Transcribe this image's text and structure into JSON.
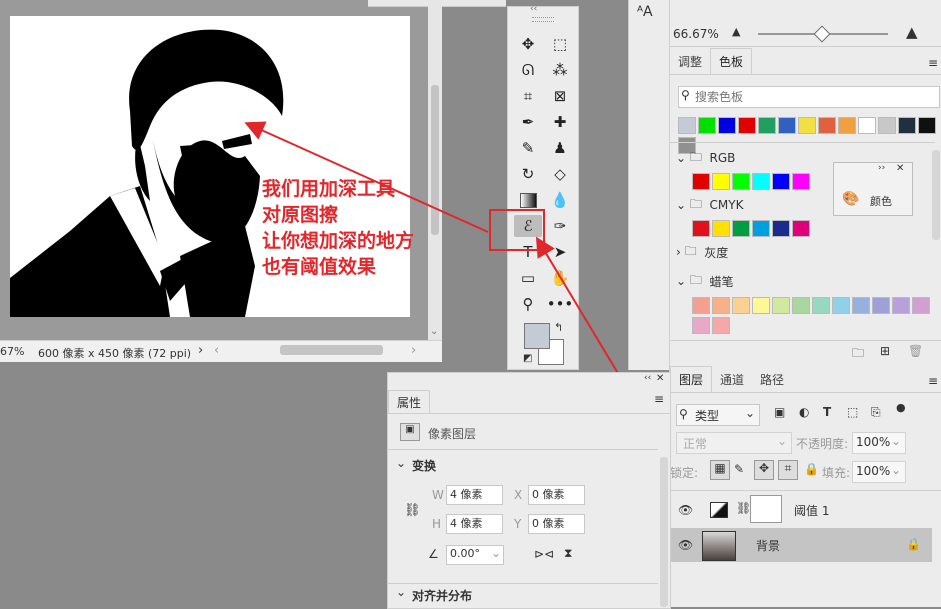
{
  "document": {
    "zoom": "67%",
    "size_info": "600 像素 x 450 像素 (72 ppi)"
  },
  "annotation": {
    "lines": [
      "我们用加深工具",
      "对原图擦",
      "让你想加深的地方",
      "也有阈值效果"
    ],
    "color": "#e0282c"
  },
  "toolbar": {
    "tools": [
      "move-icon",
      "marquee-icon",
      "lasso-icon",
      "magic-wand-icon",
      "crop-icon",
      "frame-icon",
      "eyedropper-icon",
      "healing-icon",
      "brush-icon",
      "stamp-icon",
      "history-brush-icon",
      "eraser-icon",
      "gradient-icon",
      "blur-icon",
      "burn-icon",
      "pen-icon",
      "type-icon",
      "path-select-icon",
      "rectangle-icon",
      "hand-icon",
      "zoom-icon",
      "more-icon"
    ],
    "active_tool": "burn-icon",
    "foreground": "#c5cbd5",
    "background": "#ffffff"
  },
  "navigator": {
    "zoom": "66.67%"
  },
  "swatches_panel": {
    "tabs": [
      "调整",
      "色板"
    ],
    "active_tab": "色板",
    "search_placeholder": "搜索色板",
    "recent": [
      "#c5cbd5",
      "#00e000",
      "#0000e0",
      "#e00000",
      "#20a060",
      "#3060c0",
      "#f0e040",
      "#e06040",
      "#f0a040",
      "#ffffff",
      "#c8c8c8",
      "#203040",
      "#101010",
      "#909090"
    ],
    "groups": [
      {
        "name": "RGB",
        "colors": [
          "#e00000",
          "#ffff00",
          "#00ff00",
          "#00ffff",
          "#0000ff",
          "#ff00ff"
        ]
      },
      {
        "name": "CMYK",
        "colors": [
          "#e0101c",
          "#ffe000",
          "#009e40",
          "#00a0e0",
          "#1c2c8c",
          "#e0007c"
        ]
      },
      {
        "name": "灰度",
        "colors": []
      },
      {
        "name": "蜡笔",
        "colors": [
          "#f4a090",
          "#f8b088",
          "#fcd090",
          "#fcf898",
          "#d0e8a0",
          "#a8d8a0",
          "#98d8c0",
          "#90d0e8",
          "#98b0e0",
          "#a0a0d8",
          "#b8a0d8",
          "#d0a0d0",
          "#e8a8c8",
          "#f4a8a8"
        ]
      }
    ],
    "color_popup": "颜色"
  },
  "layers_panel": {
    "tabs": [
      "图层",
      "通道",
      "路径"
    ],
    "active_tab": "图层",
    "filter": "类型",
    "blend_mode": "正常",
    "opacity_label": "不透明度:",
    "opacity": "100%",
    "lock_label": "锁定:",
    "fill_label": "填充:",
    "fill": "100%",
    "layers": [
      {
        "name": "阈值 1",
        "type": "adjustment",
        "selected": false
      },
      {
        "name": "背景",
        "type": "pixel",
        "selected": true,
        "locked": true
      }
    ]
  },
  "properties_panel": {
    "title": "属性",
    "layer_type": "像素图层",
    "transform_section": "变换",
    "w_label": "W",
    "w_value": "4 像素",
    "x_label": "X",
    "x_value": "0 像素",
    "h_label": "H",
    "h_value": "4 像素",
    "y_label": "Y",
    "y_value": "0 像素",
    "angle": "0.00°",
    "align_section": "对齐并分布"
  }
}
